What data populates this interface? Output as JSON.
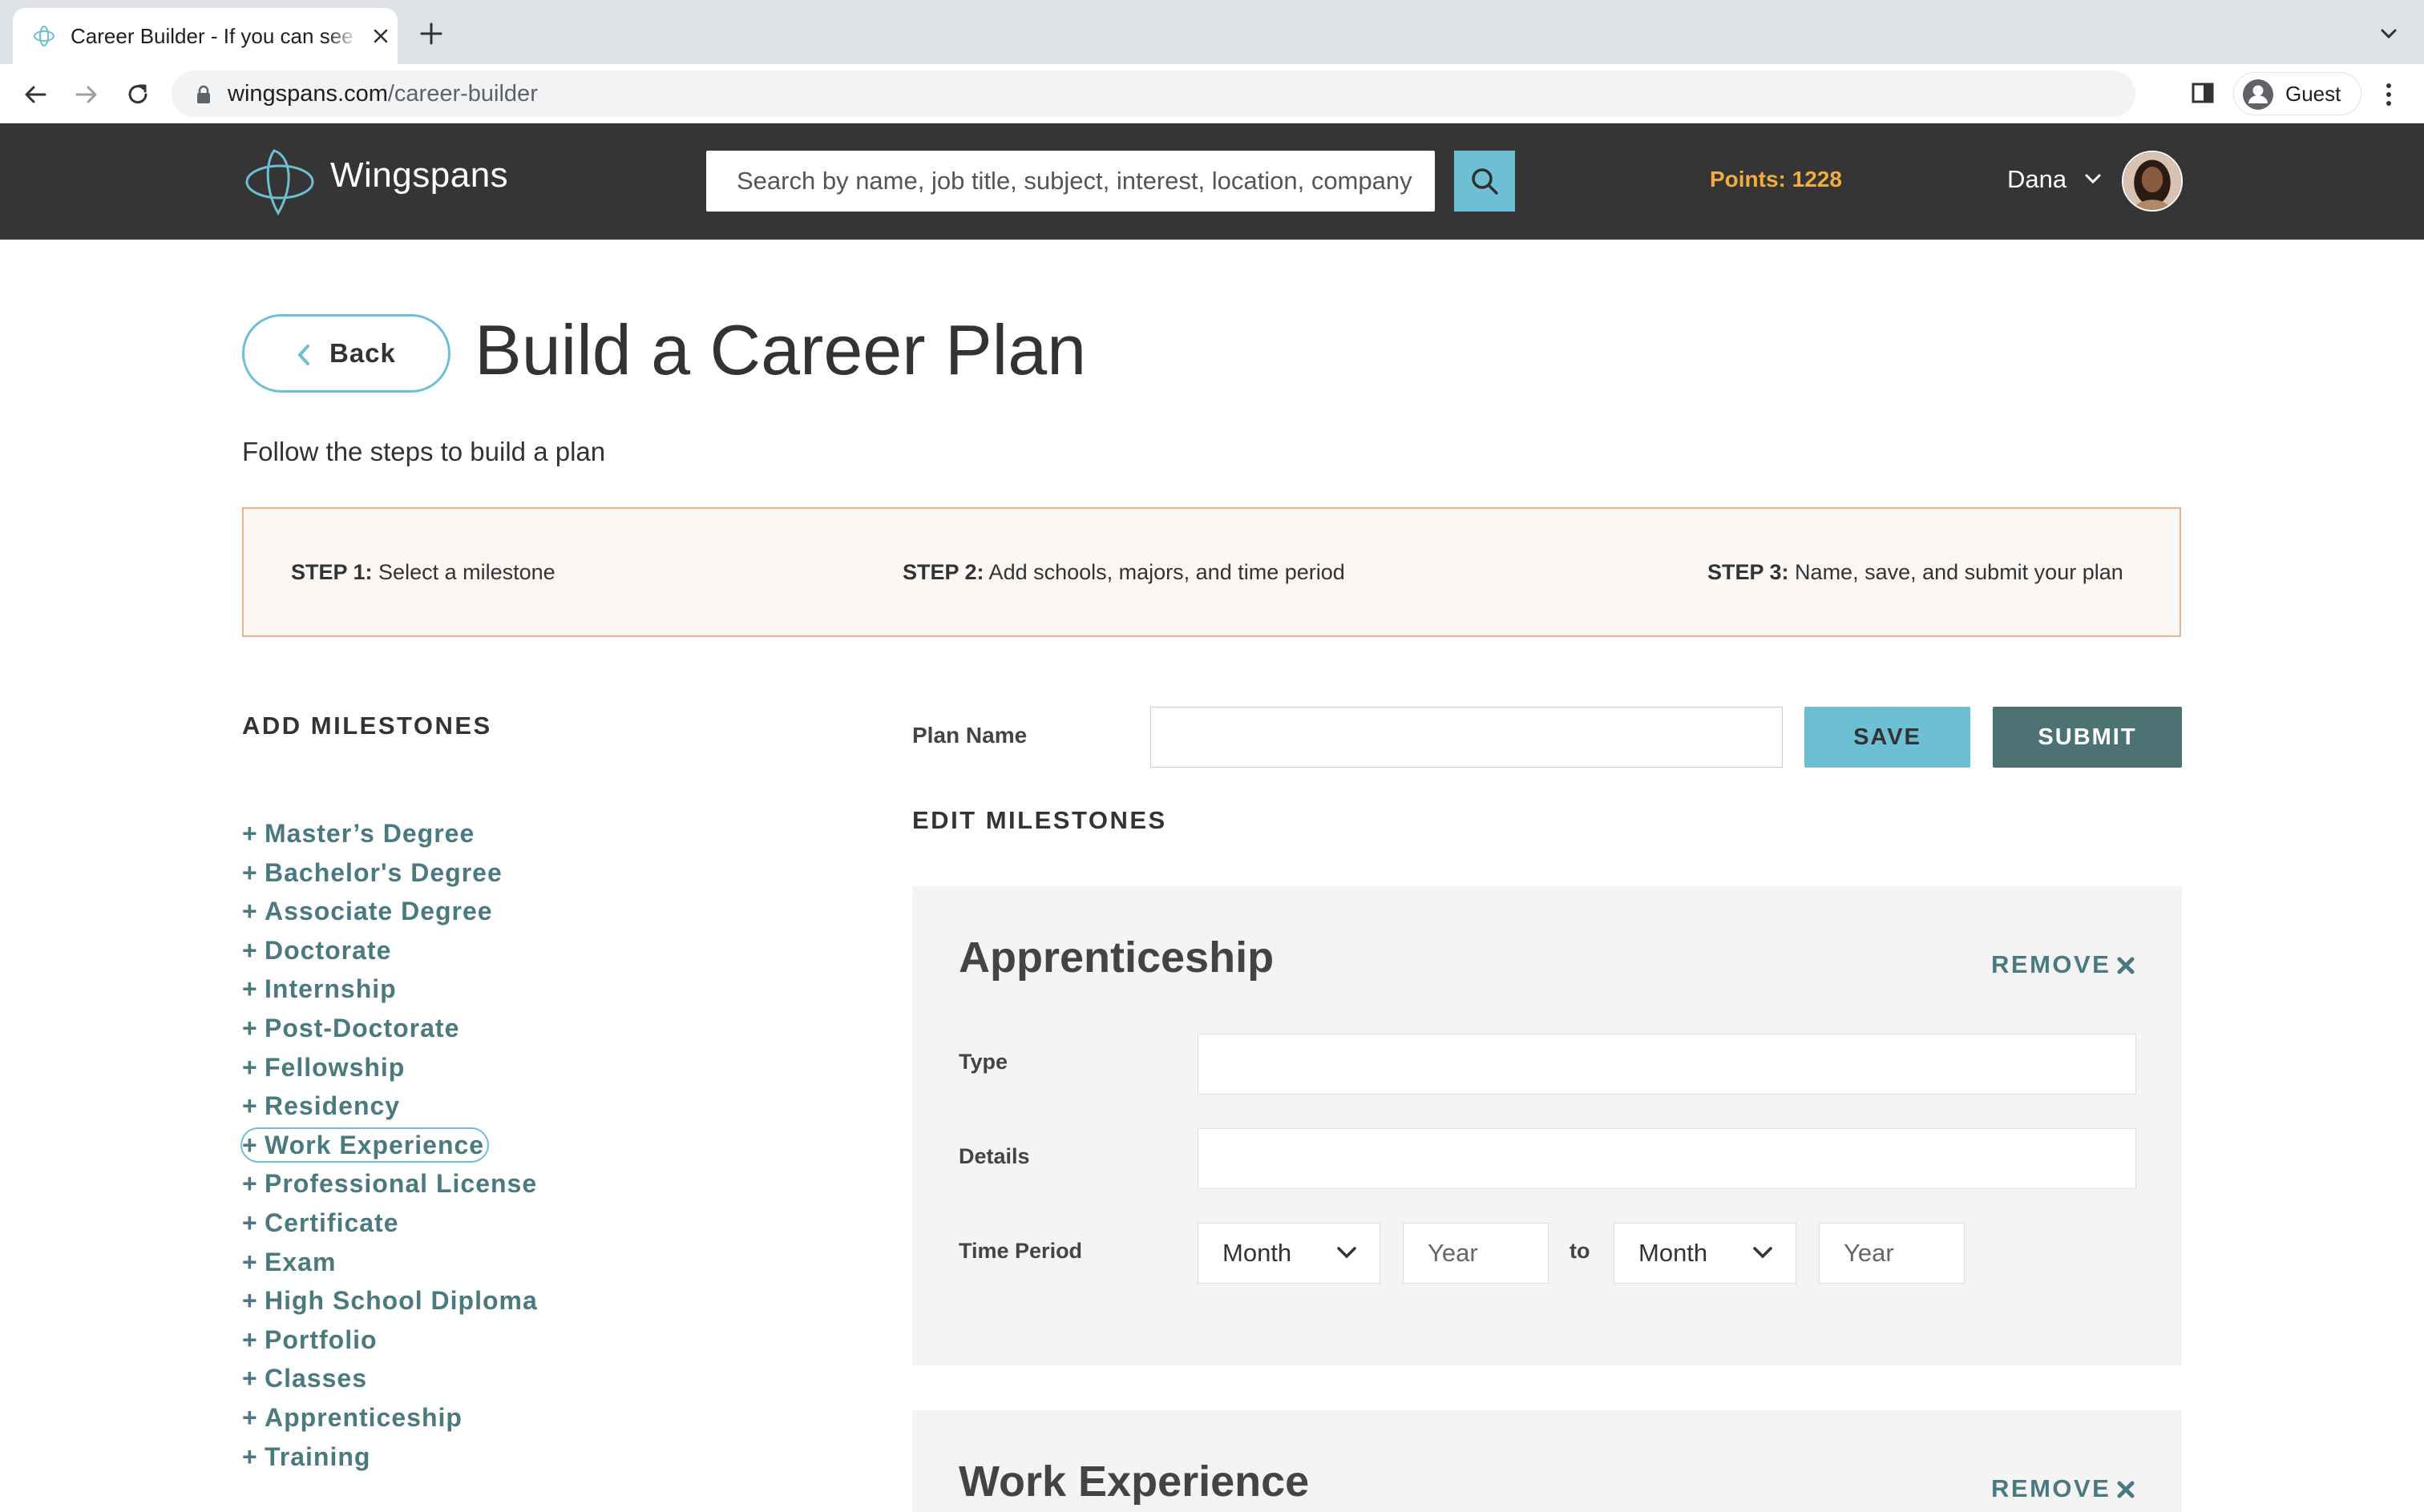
{
  "browser": {
    "tab_title": "Career Builder - If you can see",
    "url_domain": "wingspans.com",
    "url_path": "/career-builder",
    "profile_label": "Guest"
  },
  "header": {
    "brand": "Wingspans",
    "search_placeholder": "Search by name, job title, subject, interest, location, company",
    "points": "Points: 1228",
    "user_name": "Dana"
  },
  "page": {
    "back_label": "Back",
    "title": "Build a Career Plan",
    "subtitle": "Follow the steps to build a plan",
    "steps": [
      {
        "label": "STEP 1:",
        "text": " Select a milestone"
      },
      {
        "label": "STEP 2:",
        "text": " Add schools, majors, and time period"
      },
      {
        "label": "STEP 3:",
        "text": " Name, save, and submit your plan"
      }
    ]
  },
  "add_milestones": {
    "heading": "ADD MILESTONES",
    "items": [
      "Master’s Degree",
      "Bachelor's Degree",
      "Associate Degree",
      "Doctorate",
      "Internship",
      "Post-Doctorate",
      "Fellowship",
      "Residency",
      "Work Experience",
      "Professional License",
      "Certificate",
      "Exam",
      "High School Diploma",
      "Portfolio",
      "Classes",
      "Apprenticeship",
      "Training"
    ]
  },
  "plan": {
    "name_label": "Plan Name",
    "name_value": "",
    "save_label": "SAVE",
    "submit_label": "SUBMIT",
    "edit_heading": "EDIT MILESTONES"
  },
  "cards": [
    {
      "title": "Apprenticeship",
      "remove_label": "REMOVE",
      "type_label": "Type",
      "details_label": "Details",
      "time_label": "Time Period",
      "start_month": "Month",
      "start_year_placeholder": "Year",
      "to_label": "to",
      "end_month": "Month",
      "end_year_placeholder": "Year"
    },
    {
      "title": "Work Experience",
      "remove_label": "REMOVE"
    }
  ],
  "colors": {
    "header_bg": "#353535",
    "accent_teal": "#6dbfd3",
    "link_teal": "#4a7a80",
    "submit_bg": "#4d7274",
    "points_orange": "#f0ad3d",
    "steps_border": "#e8b58e"
  }
}
